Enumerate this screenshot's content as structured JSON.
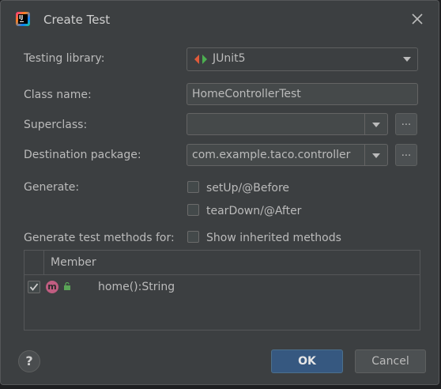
{
  "dialog": {
    "title": "Create Test",
    "app_icon": "intellij-idea-icon",
    "close_icon": "close-icon"
  },
  "form": {
    "testing_library": {
      "label": "Testing library:",
      "value": "JUnit5",
      "icon": "junit-icon"
    },
    "class_name": {
      "label": "Class name:",
      "value": "HomeControllerTest"
    },
    "superclass": {
      "label": "Superclass:",
      "value": "",
      "browse_label": "..."
    },
    "destination_package": {
      "label": "Destination package:",
      "value": "com.example.taco.controller",
      "browse_label": "..."
    },
    "generate": {
      "label": "Generate:",
      "options": [
        {
          "label": "setUp/@Before",
          "checked": false
        },
        {
          "label": "tearDown/@After",
          "checked": false
        }
      ]
    },
    "generate_methods": {
      "label": "Generate test methods for:",
      "show_inherited": {
        "label": "Show inherited methods",
        "checked": false
      }
    }
  },
  "members_table": {
    "header": "Member",
    "rows": [
      {
        "checked": true,
        "icon": "method-icon",
        "icon_letter": "m",
        "visibility_icon": "public-lock-icon",
        "name": "home():String"
      }
    ]
  },
  "footer": {
    "help_label": "?",
    "ok_label": "OK",
    "cancel_label": "Cancel"
  },
  "colors": {
    "dialog_bg": "#3c3f41",
    "field_bg": "#45494a",
    "ok_button_bg": "#365880",
    "method_icon": "#c05d81",
    "junit_green": "#4caf50",
    "junit_red": "#e05a3a"
  }
}
